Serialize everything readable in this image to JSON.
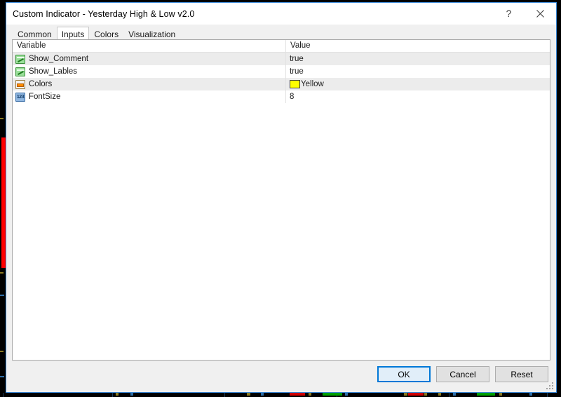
{
  "window": {
    "title": "Custom Indicator - Yesterday High & Low v2.0",
    "help_glyph": "?",
    "close_glyph": "✕",
    "accent_color": "#0078d7",
    "title_bar_color": "#ffffff",
    "dialog_background": "#f0f0f0"
  },
  "tabs": [
    {
      "label": "Common",
      "selected": false
    },
    {
      "label": "Inputs",
      "selected": true
    },
    {
      "label": "Colors",
      "selected": false
    },
    {
      "label": "Visualization",
      "selected": false
    }
  ],
  "table": {
    "columns": [
      "Variable",
      "Value"
    ],
    "rows": [
      {
        "icon": "boolean-icon",
        "variable": "Show_Comment",
        "value": "true",
        "swatch": null
      },
      {
        "icon": "boolean-icon",
        "variable": "Show_Lables",
        "value": "true",
        "swatch": null
      },
      {
        "icon": "color-icon",
        "variable": "Colors",
        "value": "Yellow",
        "swatch": "#ffff00"
      },
      {
        "icon": "number-icon",
        "variable": "FontSize",
        "value": "8",
        "swatch": null
      }
    ],
    "number_icon_text": "123"
  },
  "buttons": {
    "ok": "OK",
    "cancel": "Cancel",
    "reset": "Reset"
  },
  "background": {
    "chart_background": "#000000",
    "left_band_color": "#ff0000",
    "bullish_candle_color": "#00a000",
    "bearish_candle_color": "#d00000",
    "grid_color": "#1b3a57"
  }
}
